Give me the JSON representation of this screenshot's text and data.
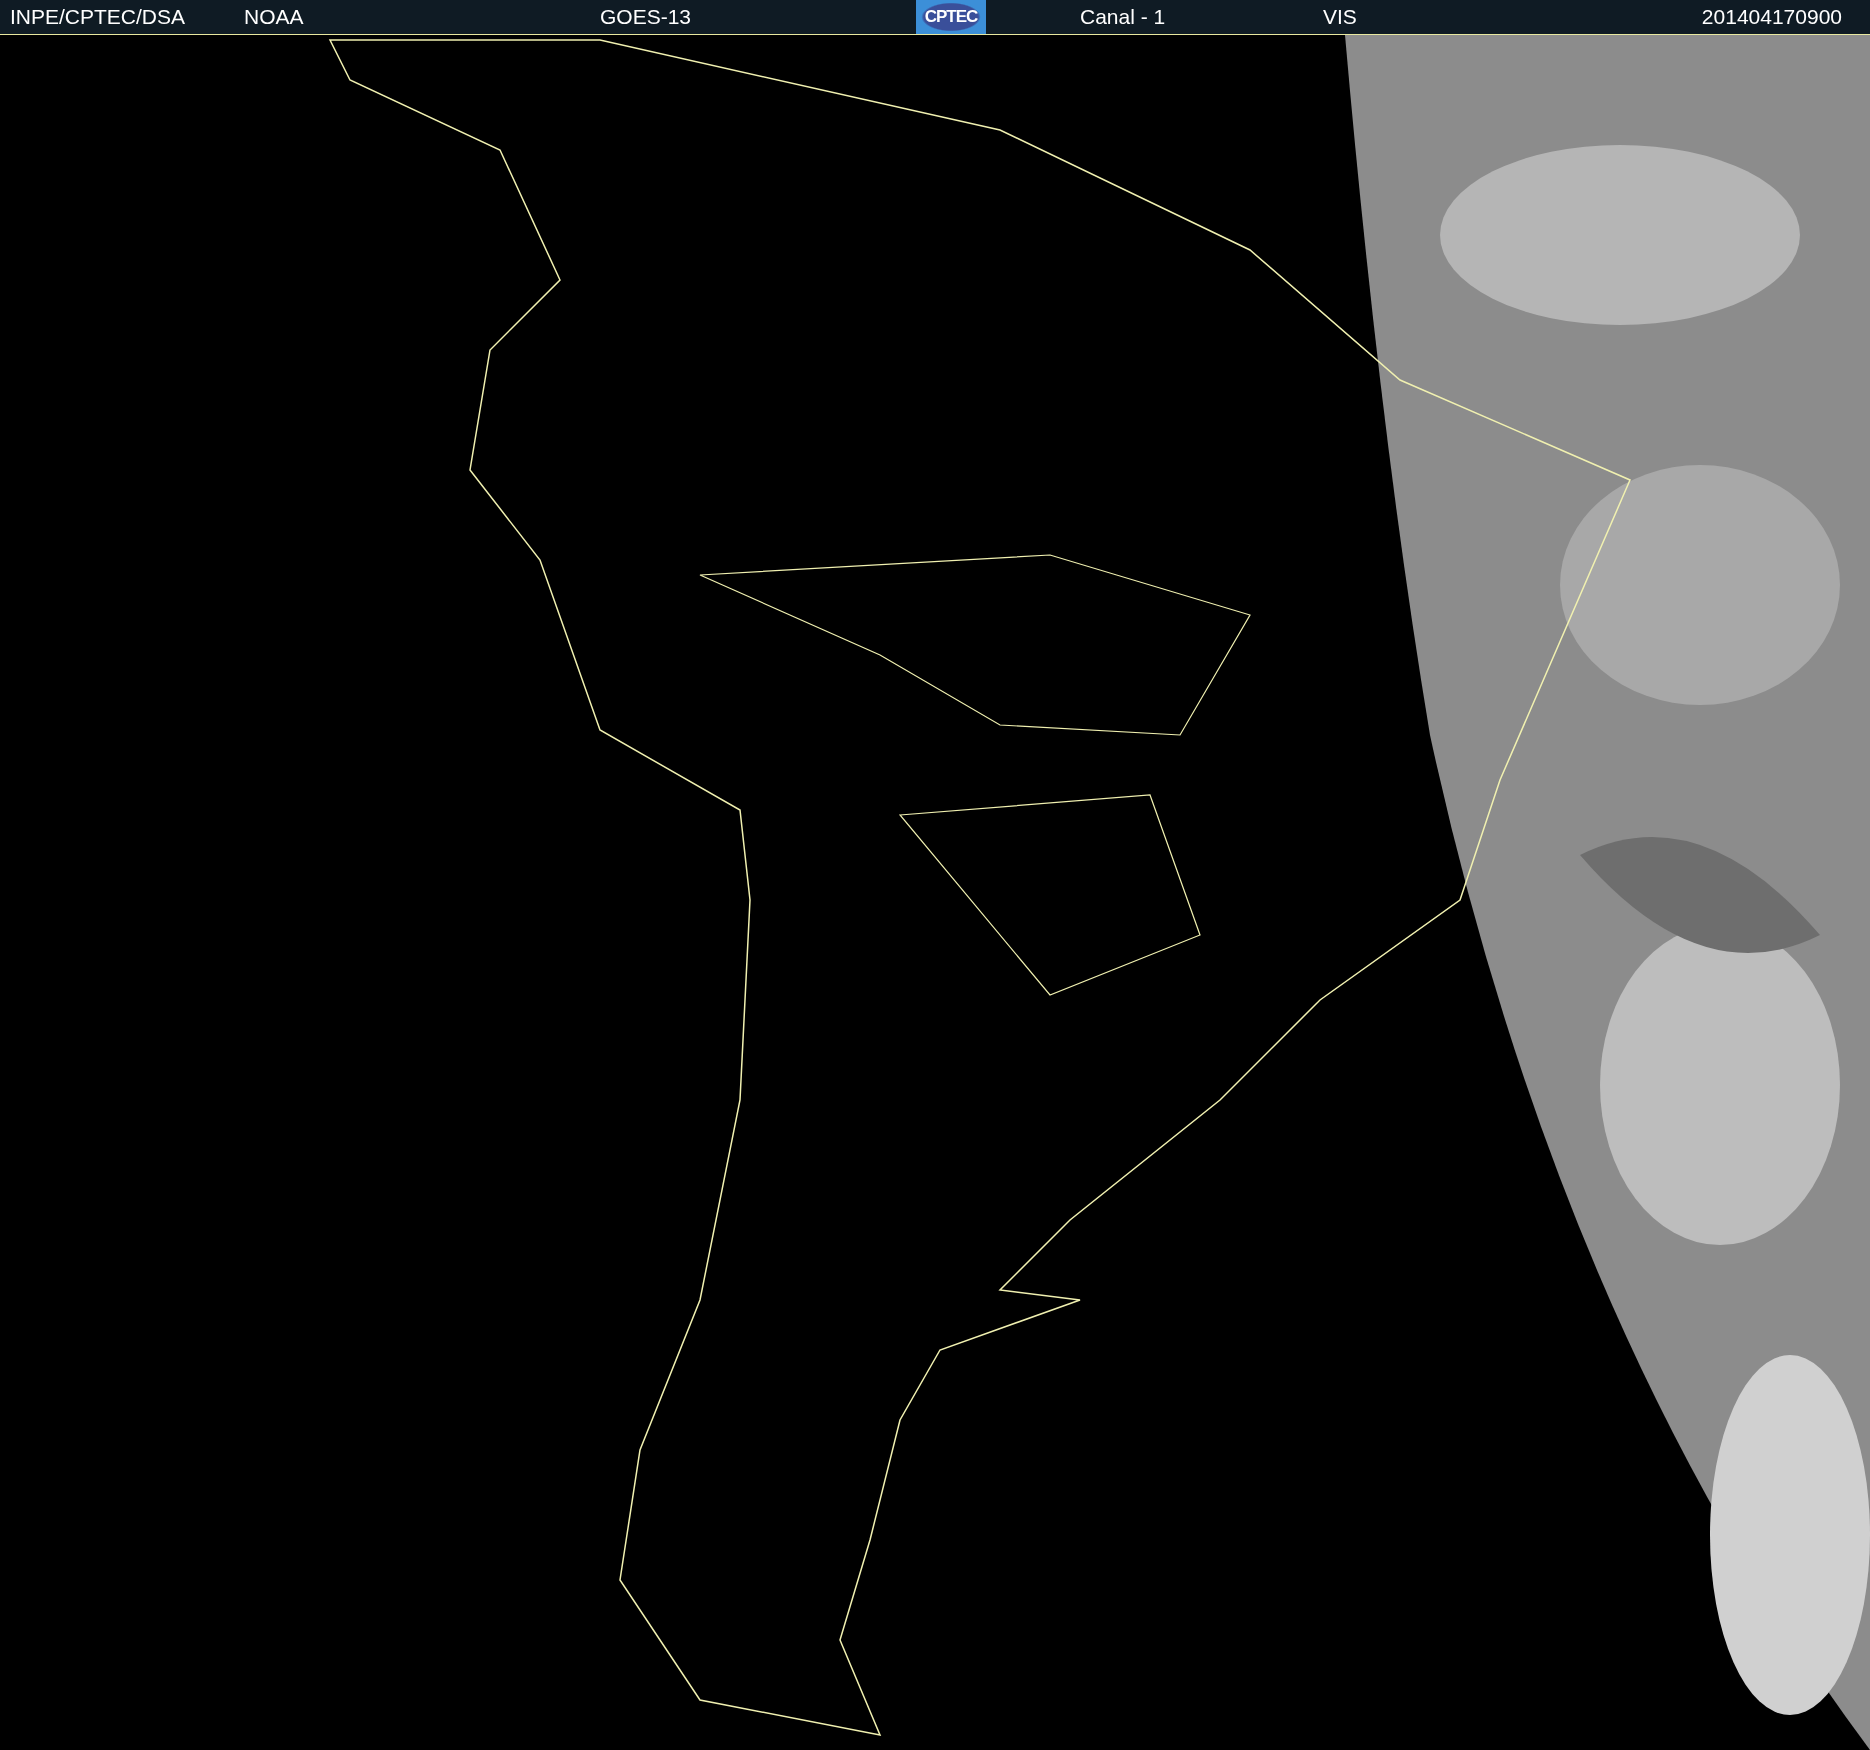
{
  "header": {
    "items": [
      {
        "kind": "text",
        "text": "INPE/CPTEC/DSA"
      },
      {
        "kind": "text",
        "text": "NOAA"
      },
      {
        "kind": "text",
        "text": "GOES-13"
      },
      {
        "kind": "logo",
        "text": "CPTEC"
      },
      {
        "kind": "text",
        "text": "Canal - 1"
      },
      {
        "kind": "text",
        "text": "VIS"
      },
      {
        "kind": "text",
        "text": "201404170900"
      }
    ]
  }
}
